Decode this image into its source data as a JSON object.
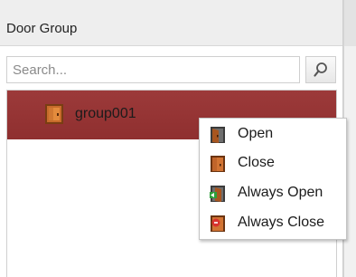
{
  "panel": {
    "title": "Door Group",
    "search": {
      "placeholder": "Search...",
      "value": ""
    },
    "search_icon": "magnifier-icon"
  },
  "tree": {
    "items": [
      {
        "label": "group001",
        "icon": "door-group-icon",
        "selected": true
      }
    ]
  },
  "context_menu": {
    "items": [
      {
        "label": "Open",
        "icon": "door-open-icon"
      },
      {
        "label": "Close",
        "icon": "door-closed-icon"
      },
      {
        "label": "Always Open",
        "icon": "door-always-open-icon"
      },
      {
        "label": "Always Close",
        "icon": "door-always-close-icon"
      }
    ]
  },
  "colors": {
    "selection": "#9c3a3a",
    "header_bg": "#eeeeee",
    "door_brown": "#b5602a",
    "accent_green": "#2e9e3a",
    "accent_red": "#d8322e"
  }
}
